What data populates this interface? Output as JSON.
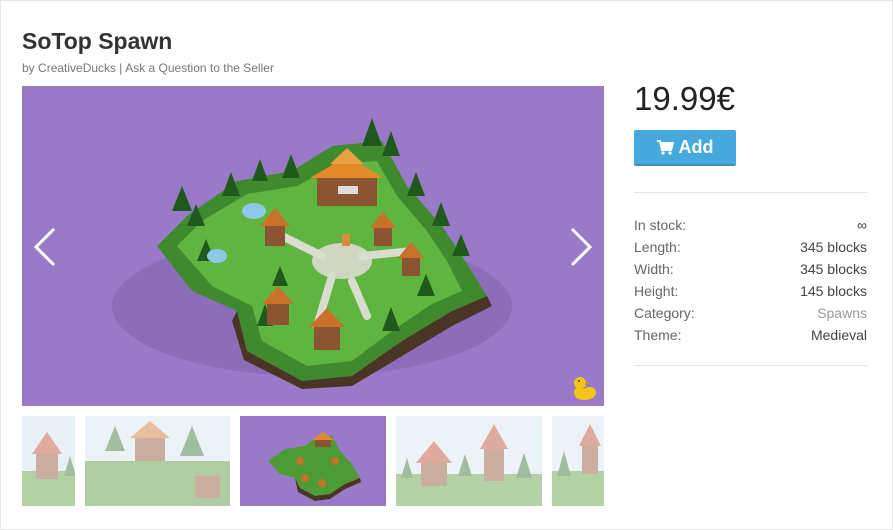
{
  "product": {
    "title": "SoTop Spawn",
    "by_prefix": "by",
    "author": "CreativeDucks",
    "separator": "|",
    "ask_link": "Ask a Question to the Seller"
  },
  "gallery": {
    "prev_icon": "chevron-left-icon",
    "next_icon": "chevron-right-icon",
    "watermark_icon": "duck-logo-icon",
    "hero_background": "#9a7ac8",
    "active_thumbnail": 3,
    "thumbnail_count": 5
  },
  "purchase": {
    "price": "19.99€",
    "add_label": "Add",
    "add_icon": "shopping-cart-icon",
    "button_color": "#45a9de"
  },
  "specs": [
    {
      "label": "In stock:",
      "value": "∞"
    },
    {
      "label": "Length:",
      "value": "345 blocks"
    },
    {
      "label": "Width:",
      "value": "345 blocks"
    },
    {
      "label": "Height:",
      "value": "145 blocks"
    },
    {
      "label": "Category:",
      "value": "Spawns"
    },
    {
      "label": "Theme:",
      "value": "Medieval"
    }
  ]
}
